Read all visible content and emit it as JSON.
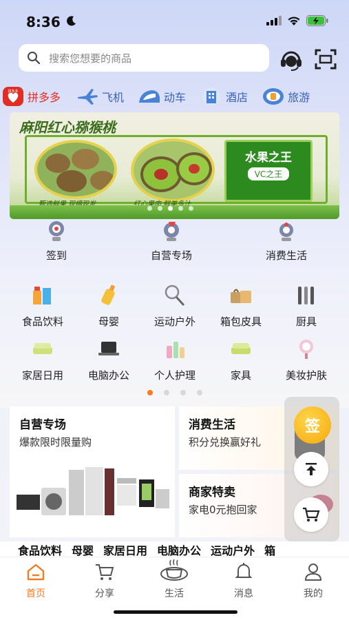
{
  "status": {
    "time": "8:36"
  },
  "search": {
    "placeholder": "搜索您想要的商品"
  },
  "quick_links": [
    {
      "label": "拼多多",
      "badge": "拼多多",
      "color": "#e02e24"
    },
    {
      "label": "飞机"
    },
    {
      "label": "动车"
    },
    {
      "label": "酒店"
    },
    {
      "label": "旅游"
    }
  ],
  "banner": {
    "title": "麻阳红心猕猴桃",
    "box_title": "水果之王",
    "box_sub": "VC之王",
    "caption_left": "甄选鲜果 现摘现发",
    "caption_right": "红心果肉 鲜美多汁"
  },
  "features": [
    {
      "label": "签到"
    },
    {
      "label": "自营专场"
    },
    {
      "label": "消费生活"
    }
  ],
  "categories": [
    {
      "label": "食品饮料"
    },
    {
      "label": "母婴"
    },
    {
      "label": "运动户外"
    },
    {
      "label": "箱包皮具"
    },
    {
      "label": "厨具"
    },
    {
      "label": "家居日用"
    },
    {
      "label": "电脑办公"
    },
    {
      "label": "个人护理"
    },
    {
      "label": "家具"
    },
    {
      "label": "美妆护肤"
    }
  ],
  "promos": {
    "self": {
      "title": "自营专场",
      "sub": "爆款限时限量购"
    },
    "life": {
      "title": "消费生活",
      "sub": "积分兑换赢好礼"
    },
    "merchant": {
      "title": "商家特卖",
      "sub": "家电0元抱回家"
    }
  },
  "floating": {
    "sign_label": "签"
  },
  "category_tabs": [
    "食品饮料",
    "母婴",
    "家居日用",
    "电脑办公",
    "运动户外",
    "箱"
  ],
  "tabbar": [
    {
      "label": "首页",
      "active": true
    },
    {
      "label": "分享"
    },
    {
      "label": "生活"
    },
    {
      "label": "消息"
    },
    {
      "label": "我的"
    }
  ],
  "colors": {
    "accent": "#f07b20",
    "link_blue": "#3a63b8",
    "kiwi_green": "#2d8a1f"
  }
}
